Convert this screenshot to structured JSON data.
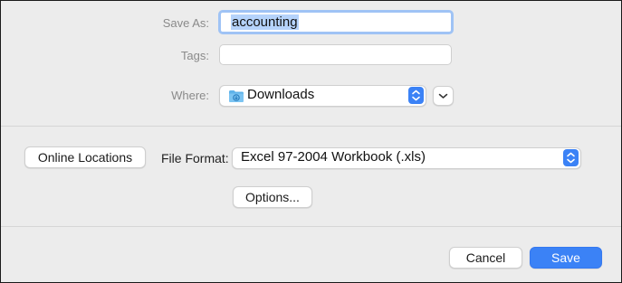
{
  "save_as": {
    "label": "Save As:",
    "value": "accounting"
  },
  "tags": {
    "label": "Tags:",
    "value": ""
  },
  "where": {
    "label": "Where:",
    "value": "Downloads",
    "icon": "downloads-folder-icon"
  },
  "online_locations_label": "Online Locations",
  "file_format": {
    "label": "File Format:",
    "value": "Excel 97-2004 Workbook (.xls)"
  },
  "options_label": "Options...",
  "buttons": {
    "cancel": "Cancel",
    "save": "Save"
  },
  "colors": {
    "accent": "#3b82f6",
    "selection": "#b5d3fb",
    "focus_ring": "#9fc3f5",
    "background": "#ececec"
  }
}
